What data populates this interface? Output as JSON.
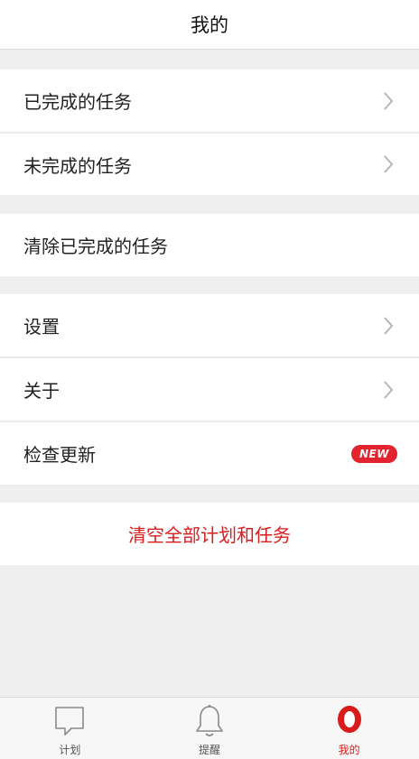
{
  "header": {
    "title": "我的"
  },
  "menu": {
    "completed_tasks": "已完成的任务",
    "incomplete_tasks": "未完成的任务",
    "clear_completed": "清除已完成的任务",
    "settings": "设置",
    "about": "关于",
    "check_update": "检查更新",
    "new_badge": "NEW",
    "clear_all": "清空全部计划和任务"
  },
  "tabbar": {
    "tabs": [
      {
        "label": "计划",
        "icon": "chat-bubble-icon",
        "active": false
      },
      {
        "label": "提醒",
        "icon": "bell-icon",
        "active": false
      },
      {
        "label": "我的",
        "icon": "profile-icon",
        "active": true
      }
    ]
  },
  "colors": {
    "accent": "#d91c1c",
    "badge": "#e3232e",
    "background": "#efefef"
  }
}
